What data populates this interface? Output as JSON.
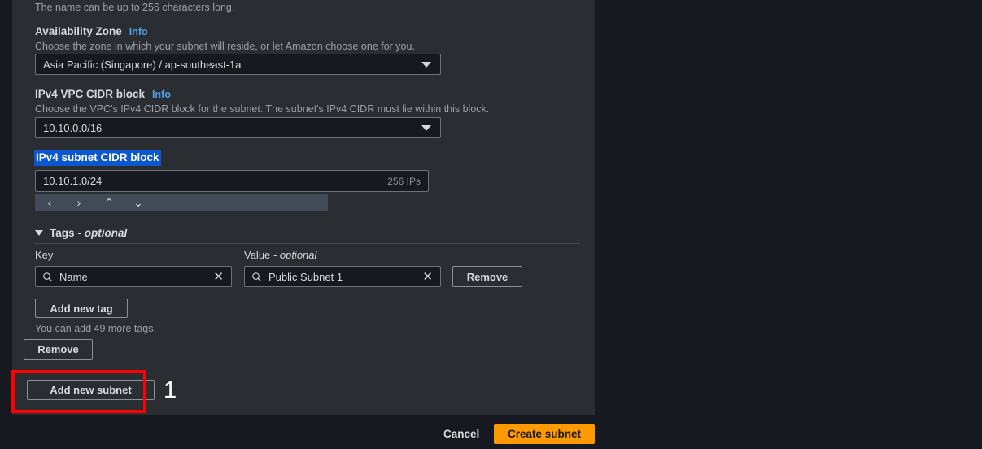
{
  "form": {
    "name_helper": "The name can be up to 256 characters long.",
    "availability_zone": {
      "label": "Availability Zone",
      "info": "Info",
      "helper": "Choose the zone in which your subnet will reside, or let Amazon choose one for you.",
      "value": "Asia Pacific (Singapore) / ap-southeast-1a"
    },
    "vpc_cidr": {
      "label": "IPv4 VPC CIDR block",
      "info": "Info",
      "helper": "Choose the VPC's IPv4 CIDR block for the subnet. The subnet's IPv4 CIDR must lie within this block.",
      "value": "10.10.0.0/16"
    },
    "subnet_cidr": {
      "label": "IPv4 subnet CIDR block",
      "value": "10.10.1.0/24",
      "ip_count": "256 IPs",
      "stepper": {
        "prev": "‹",
        "next": "›",
        "up": "⌃",
        "down": "⌄"
      }
    },
    "tags": {
      "header": "Tags",
      "header_optional": "- optional",
      "key_label": "Key",
      "value_label": "Value",
      "value_label_optional": "- optional",
      "rows": [
        {
          "key": "Name",
          "value": "Public Subnet 1",
          "remove_label": "Remove"
        }
      ],
      "add_tag_label": "Add new tag",
      "limit_helper": "You can add 49 more tags."
    },
    "remove_subnet_label": "Remove",
    "add_subnet_label": "Add new subnet"
  },
  "footer": {
    "cancel_label": "Cancel",
    "create_label": "Create subnet"
  },
  "annotation": {
    "number": "1",
    "color": "#ff0000"
  }
}
